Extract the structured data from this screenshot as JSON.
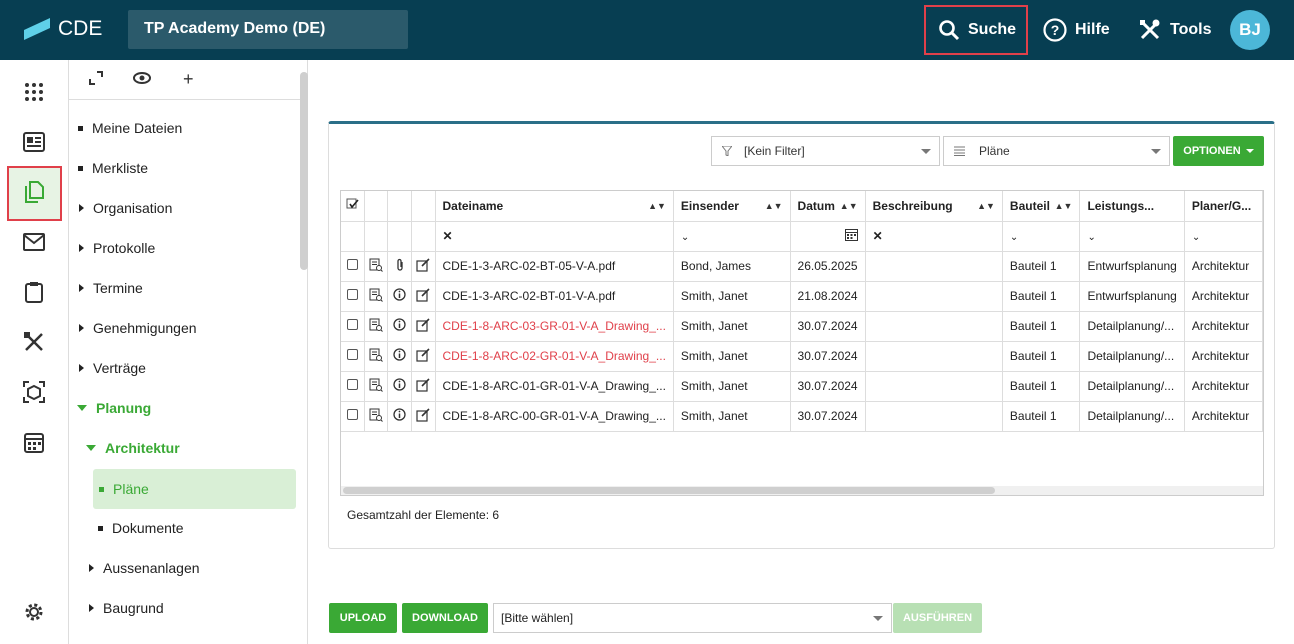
{
  "header": {
    "logo_text": "CDE",
    "project": "TP Academy Demo (DE)",
    "search_label": "Suche",
    "help_label": "Hilfe",
    "tools_label": "Tools",
    "avatar_initials": "BJ"
  },
  "tree": {
    "items": [
      {
        "label": "Meine Dateien"
      },
      {
        "label": "Merkliste"
      },
      {
        "label": "Organisation"
      },
      {
        "label": "Protokolle"
      },
      {
        "label": "Termine"
      },
      {
        "label": "Genehmigungen"
      },
      {
        "label": "Verträge"
      },
      {
        "label": "Planung"
      },
      {
        "label": "Architektur"
      },
      {
        "label": "Pläne"
      },
      {
        "label": "Dokumente"
      },
      {
        "label": "Aussenanlagen"
      },
      {
        "label": "Baugrund"
      }
    ]
  },
  "filters": {
    "filter_value": "[Kein Filter]",
    "view_value": "Pläne",
    "options_label": "OPTIONEN"
  },
  "grid": {
    "columns": [
      "Dateiname",
      "Einsender",
      "Datum",
      "Beschreibung",
      "Bauteil",
      "Leistungs...",
      "Planer/G..."
    ],
    "rows": [
      {
        "name": "CDE-1-3-ARC-02-BT-05-V-A.pdf",
        "sender": "Bond, James",
        "date": "26.05.2025",
        "desc": "",
        "part": "Bauteil 1",
        "phase": "Entwurfsplanung",
        "planner": "Architektur"
      },
      {
        "name": "CDE-1-3-ARC-02-BT-01-V-A.pdf",
        "sender": "Smith, Janet",
        "date": "21.08.2024",
        "desc": "",
        "part": "Bauteil 1",
        "phase": "Entwurfsplanung",
        "planner": "Architektur"
      },
      {
        "name": "CDE-1-8-ARC-03-GR-01-V-A_Drawing_...",
        "sender": "Smith, Janet",
        "date": "30.07.2024",
        "desc": "",
        "part": "Bauteil 1",
        "phase": "Detailplanung/...",
        "planner": "Architektur"
      },
      {
        "name": "CDE-1-8-ARC-02-GR-01-V-A_Drawing_...",
        "sender": "Smith, Janet",
        "date": "30.07.2024",
        "desc": "",
        "part": "Bauteil 1",
        "phase": "Detailplanung/...",
        "planner": "Architektur"
      },
      {
        "name": "CDE-1-8-ARC-01-GR-01-V-A_Drawing_...",
        "sender": "Smith, Janet",
        "date": "30.07.2024",
        "desc": "",
        "part": "Bauteil 1",
        "phase": "Detailplanung/...",
        "planner": "Architektur"
      },
      {
        "name": "CDE-1-8-ARC-00-GR-01-V-A_Drawing_...",
        "sender": "Smith, Janet",
        "date": "30.07.2024",
        "desc": "",
        "part": "Bauteil 1",
        "phase": "Detailplanung/...",
        "planner": "Architektur"
      }
    ],
    "total_label": "Gesamtzahl der Elemente: 6"
  },
  "actions": {
    "upload_label": "UPLOAD",
    "download_label": "DOWNLOAD",
    "select_value": "[Bitte wählen]",
    "execute_label": "AUSFÜHREN"
  },
  "colors": {
    "header_bg": "#073e52",
    "accent_green": "#3aa935",
    "highlight_red": "#e0404a"
  }
}
